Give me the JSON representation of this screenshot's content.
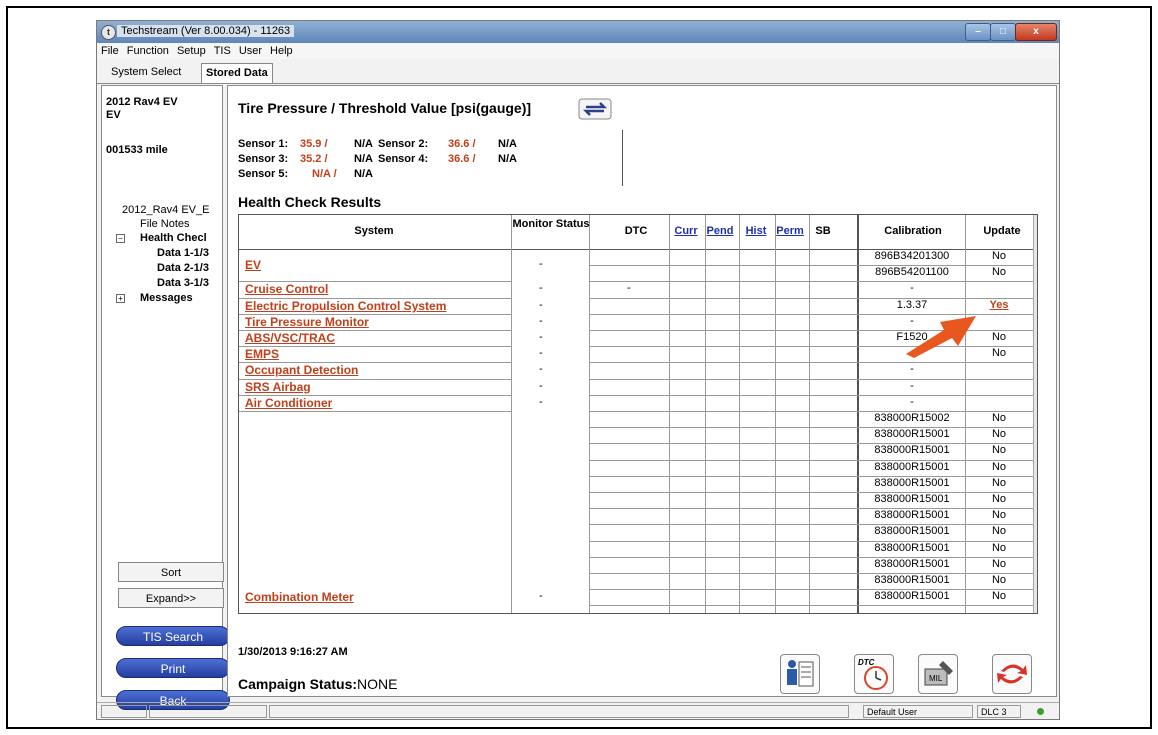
{
  "window": {
    "title": "Techstream (Ver 8.00.034) - 11263",
    "minimize": "–",
    "maximize": "□",
    "close": "x"
  },
  "menu": [
    "File",
    "Function",
    "Setup",
    "TIS",
    "User",
    "Help"
  ],
  "tabs": [
    "System Select",
    "Stored Data"
  ],
  "sidebar": {
    "vehicle_line1": "2012 Rav4 EV",
    "vehicle_line2": "EV",
    "mileage": "001533 mile",
    "tree": {
      "root": "2012_Rav4 EV_E",
      "file_notes": "File Notes",
      "health_check": "Health Checl",
      "data1": "Data 1-1/3",
      "data2": "Data 2-1/3",
      "data3": "Data 3-1/3",
      "messages": "Messages"
    },
    "sort_label": "Sort",
    "expand_label": "Expand>>",
    "tis_search_label": "TIS Search",
    "print_label": "Print",
    "back_label": "Back"
  },
  "tire_pressure": {
    "title": "Tire Pressure / Threshold Value [psi(gauge)]",
    "sensor1_label": "Sensor 1:",
    "sensor1_value": "35.9 /",
    "sensor1_threshold": "N/A",
    "sensor2_label": "Sensor 2:",
    "sensor2_value": "36.6 /",
    "sensor2_threshold": "N/A",
    "sensor3_label": "Sensor 3:",
    "sensor3_value": "35.2 /",
    "sensor3_threshold": "N/A",
    "sensor4_label": "Sensor 4:",
    "sensor4_value": "36.6 /",
    "sensor4_threshold": "N/A",
    "sensor5_label": "Sensor 5:",
    "sensor5_value": "N/A /",
    "sensor5_threshold": "N/A"
  },
  "health": {
    "title": "Health Check Results",
    "columns": {
      "system": "System",
      "monitor_status": "Monitor Status",
      "dtc": "DTC",
      "curr": "Curr",
      "pend": "Pend",
      "hist": "Hist",
      "perm": "Perm",
      "sb": "SB",
      "calibration": "Calibration",
      "update": "Update"
    },
    "systems": [
      {
        "name": "EV",
        "status": "-",
        "dtc": ""
      },
      {
        "name": "Cruise Control",
        "status": "-",
        "dtc": "-"
      },
      {
        "name": "Electric Propulsion Control System",
        "status": "-",
        "dtc": ""
      },
      {
        "name": "Tire Pressure Monitor",
        "status": "-",
        "dtc": ""
      },
      {
        "name": "ABS/VSC/TRAC",
        "status": "-",
        "dtc": ""
      },
      {
        "name": "EMPS",
        "status": "-",
        "dtc": ""
      },
      {
        "name": "Occupant Detection",
        "status": "-",
        "dtc": ""
      },
      {
        "name": "SRS Airbag",
        "status": "-",
        "dtc": ""
      },
      {
        "name": "Air Conditioner",
        "status": "-",
        "dtc": ""
      },
      {
        "name": "Combination Meter",
        "status": "-",
        "dtc": ""
      }
    ],
    "calibration_rows": [
      {
        "cal": "896B34201300",
        "upd": "No"
      },
      {
        "cal": "896B54201100",
        "upd": "No"
      },
      {
        "cal": "-",
        "upd": ""
      },
      {
        "cal": "1.3.37",
        "upd": "Yes"
      },
      {
        "cal": "-",
        "upd": ""
      },
      {
        "cal": "F1520",
        "upd": "No"
      },
      {
        "cal": "",
        "upd": "No"
      },
      {
        "cal": "-",
        "upd": ""
      },
      {
        "cal": "-",
        "upd": ""
      },
      {
        "cal": "-",
        "upd": ""
      },
      {
        "cal": "838000R15002",
        "upd": "No"
      },
      {
        "cal": "838000R15001",
        "upd": "No"
      },
      {
        "cal": "838000R15001",
        "upd": "No"
      },
      {
        "cal": "838000R15001",
        "upd": "No"
      },
      {
        "cal": "838000R15001",
        "upd": "No"
      },
      {
        "cal": "838000R15001",
        "upd": "No"
      },
      {
        "cal": "838000R15001",
        "upd": "No"
      },
      {
        "cal": "838000R15001",
        "upd": "No"
      },
      {
        "cal": "838000R15001",
        "upd": "No"
      },
      {
        "cal": "838000R15001",
        "upd": "No"
      },
      {
        "cal": "838000R15001",
        "upd": "No"
      },
      {
        "cal": "838000R15001",
        "upd": "No"
      }
    ]
  },
  "footer": {
    "timestamp": "1/30/2013 9:16:27 AM",
    "campaign_label": "Campaign Status:",
    "campaign_value": "NONE",
    "dtc_icon_text": "DTC",
    "mil_icon_text": "MIL"
  },
  "statusbar": {
    "user": "Default User",
    "dlc": "DLC 3"
  },
  "colors": {
    "accent_red": "#c0401b",
    "arrow": "#e8581e",
    "pill_blue": "#2f4bb7",
    "status_green": "#3ba02a"
  }
}
